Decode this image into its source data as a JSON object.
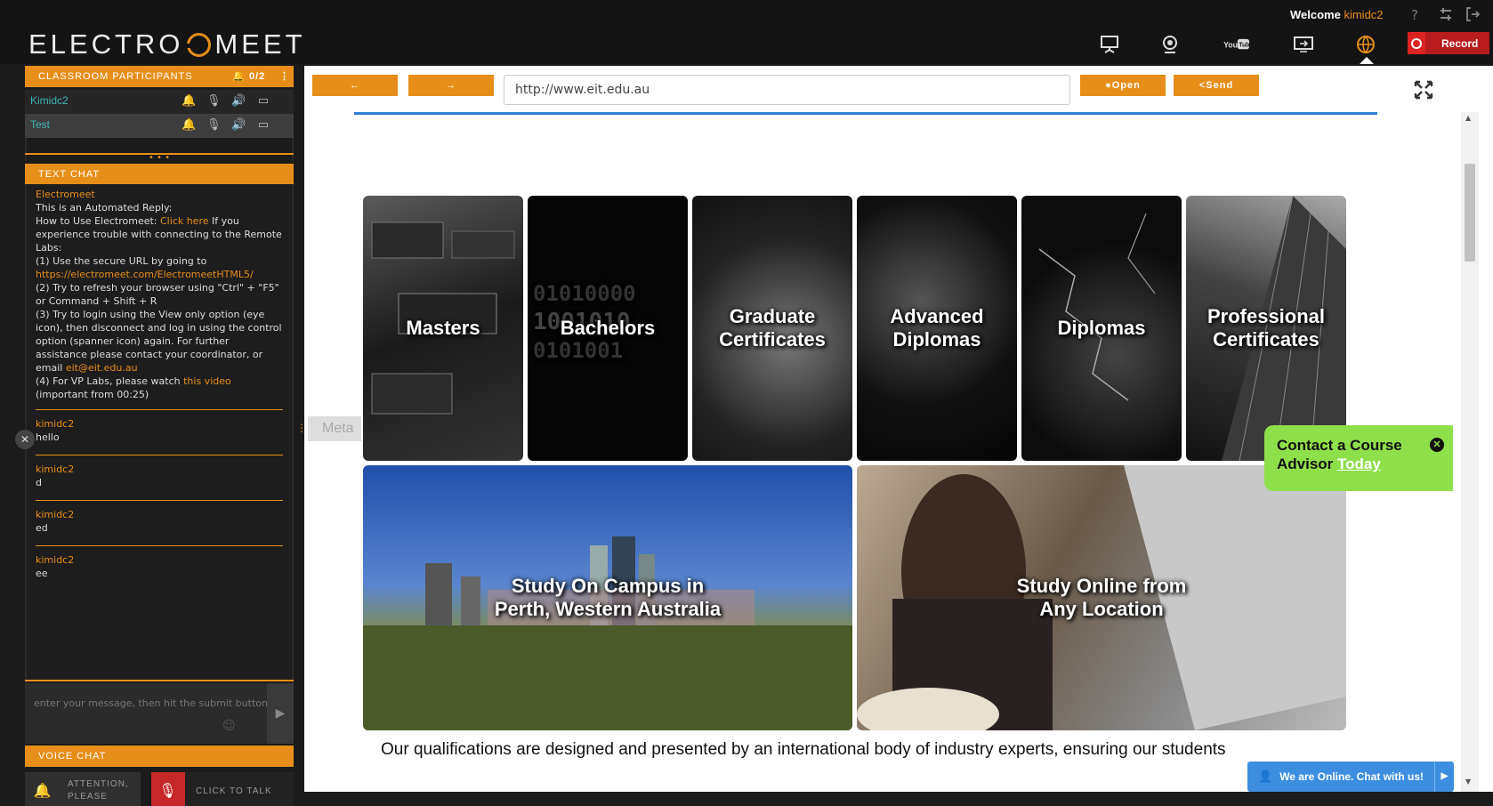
{
  "app": {
    "logo": "ELECTRO",
    "logo_suffix": "MEET",
    "welcome": "Welcome",
    "username": "kimidc2",
    "record_label": "Record"
  },
  "colors": {
    "accent": "#e78e1a",
    "record": "#b81c1c",
    "contact_bg": "#8ee04a",
    "chat_online_bg": "#3d8ee0"
  },
  "topnav": {
    "icons": [
      "whiteboard-icon",
      "webcam-icon",
      "youtube-icon",
      "screen-share-icon",
      "web-browser-icon"
    ],
    "utility_icons": [
      "help-icon",
      "settings-icon",
      "logout-icon"
    ]
  },
  "participants": {
    "header": "CLASSROOM PARTICIPANTS",
    "count": "0/2",
    "rows": [
      {
        "name": "Kimidc2"
      },
      {
        "name": "Test"
      }
    ]
  },
  "chat": {
    "header": "TEXT CHAT",
    "auto_sender": "Electromeet",
    "auto_lines": {
      "l1": "This is an Automated Reply:",
      "l2a": "How to Use Electromeet: ",
      "l2link": "Click here",
      "l2b": " If you experience trouble with connecting to the Remote Labs:",
      "l3": "(1) Use the secure URL by going to",
      "l3link": "https://electromeet.com/ElectromeetHTML5/",
      "l4": "(2) Try to refresh your browser using \"Ctrl\" + \"F5\" or Command + Shift + R",
      "l5a": "(3) Try to login using the View only option (eye icon), then disconnect and log in using the control option (spanner icon) again. For further assistance please contact your coordinator, or email ",
      "l5link": "eit@eit.edu.au",
      "l6a": "(4) For VP Labs, please watch ",
      "l6link": "this video",
      "l6b": " (important from 00:25)"
    },
    "messages": [
      {
        "sender": "kimidc2",
        "text": "hello"
      },
      {
        "sender": "kimidc2",
        "text": "d"
      },
      {
        "sender": "kimidc2",
        "text": "ed"
      },
      {
        "sender": "kimidc2",
        "text": "ee"
      }
    ],
    "input_placeholder": "enter your message, then hit the submit button"
  },
  "voice": {
    "header": "VOICE CHAT",
    "attention_label": "ATTENTION, PLEASE",
    "talk_label": "CLICK TO TALK"
  },
  "browser": {
    "back_label": "←",
    "forward_label": "→",
    "url": "http://www.eit.edu.au",
    "open_label": "Open",
    "send_label": "Send",
    "meta_tab": "Meta",
    "tiles": [
      "Masters",
      "Bachelors",
      "Graduate Certificates",
      "Advanced Diplomas",
      "Diplomas",
      "Professional Certificates"
    ],
    "wide_tiles": [
      "Study On Campus in Perth, Western Australia",
      "Study Online from Any Location"
    ],
    "body_text": "Our qualifications are designed and presented by an international body of industry experts, ensuring our students",
    "contact_line1": "Contact a Course",
    "contact_line2": "Advisor",
    "contact_today": "Today",
    "chat_online": "We are Online. Chat with us!"
  }
}
